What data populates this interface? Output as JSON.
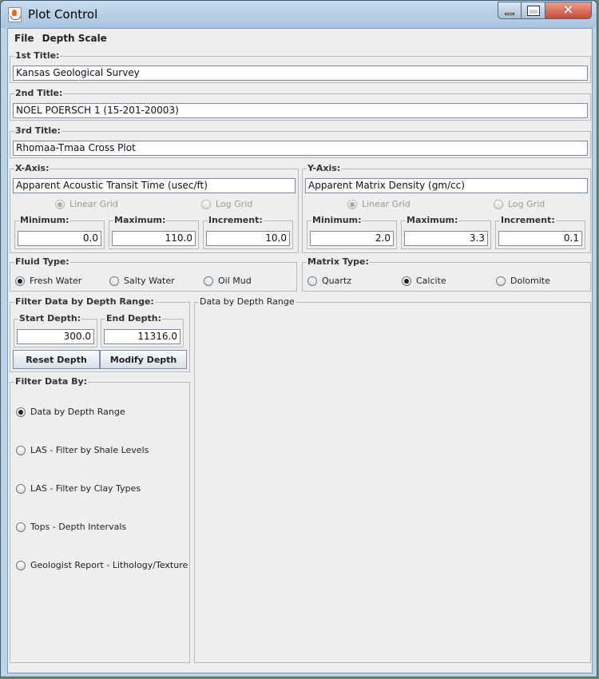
{
  "window": {
    "title": "Plot Control"
  },
  "menubar": {
    "file": "File",
    "depth_scale": "Depth Scale"
  },
  "titles": {
    "first_label": "1st Title:",
    "first_value": "Kansas Geological Survey",
    "second_label": "2nd Title:",
    "second_value": "NOEL POERSCH 1 (15-201-20003)",
    "third_label": "3rd Title:",
    "third_value": "Rhomaa-Tmaa Cross Plot"
  },
  "x_axis": {
    "label": "X-Axis:",
    "value": "Apparent Acoustic Transit Time (usec/ft)",
    "linear_grid": "Linear Grid",
    "log_grid": "Log Grid",
    "min_label": "Minimum:",
    "min_value": "0.0",
    "max_label": "Maximum:",
    "max_value": "110.0",
    "inc_label": "Increment:",
    "inc_value": "10.0"
  },
  "y_axis": {
    "label": "Y-Axis:",
    "value": "Apparent Matrix Density (gm/cc)",
    "linear_grid": "Linear Grid",
    "log_grid": "Log Grid",
    "min_label": "Minimum:",
    "min_value": "2.0",
    "max_label": "Maximum:",
    "max_value": "3.3",
    "inc_label": "Increment:",
    "inc_value": "0.1"
  },
  "fluid": {
    "label": "Fluid Type:",
    "fresh": "Fresh Water",
    "salty": "Salty Water",
    "oil": "Oil Mud",
    "selected": "Fresh Water"
  },
  "matrix": {
    "label": "Matrix Type:",
    "quartz": "Quartz",
    "calcite": "Calcite",
    "dolomite": "Dolomite",
    "selected": "Calcite"
  },
  "depth_filter": {
    "label": "Filter Data by Depth Range:",
    "start_label": "Start Depth:",
    "start_value": "300.0",
    "end_label": "End Depth:",
    "end_value": "11316.0",
    "reset_button": "Reset Depth",
    "modify_button": "Modify Depth"
  },
  "filter_by": {
    "label": "Filter Data By:",
    "options": [
      "Data by Depth Range",
      "LAS - Filter by Shale Levels",
      "LAS - Filter by Clay Types",
      "Tops - Depth Intervals",
      "Geologist Report - Lithology/Texture"
    ],
    "selected": "Data by Depth Range"
  },
  "data_panel": {
    "label": "Data by Depth Range"
  }
}
